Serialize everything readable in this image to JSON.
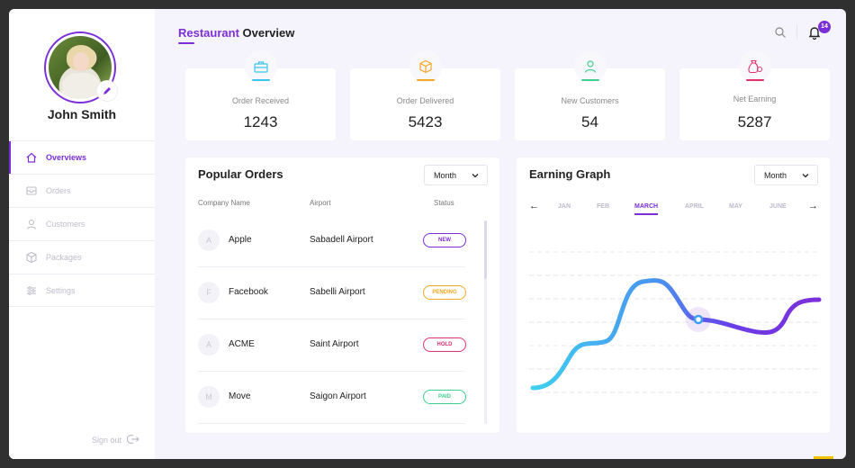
{
  "colors": {
    "accent": "#7b2fd9",
    "new": "#7b2fd9",
    "pending": "#f5a623",
    "hold": "#e0336b",
    "paid": "#3ecf8e"
  },
  "user": {
    "name": "John Smith",
    "edit_icon": "pencil-icon"
  },
  "nav": [
    {
      "label": "Overviews",
      "icon": "home-icon",
      "active": true
    },
    {
      "label": "Orders",
      "icon": "inbox-icon",
      "active": false
    },
    {
      "label": "Customers",
      "icon": "user-icon",
      "active": false
    },
    {
      "label": "Packages",
      "icon": "package-icon",
      "active": false
    },
    {
      "label": "Settings",
      "icon": "sliders-icon",
      "active": false
    }
  ],
  "signout": {
    "label": "Sign out",
    "icon": "sign-out-icon"
  },
  "header": {
    "title_accent": "Restaurant",
    "title_rest": " Overview",
    "notifications": "14"
  },
  "stats": [
    {
      "label": "Order Received",
      "value": "1243",
      "icon": "briefcase-icon",
      "color": "#3cc4e8"
    },
    {
      "label": "Order Delivered",
      "value": "5423",
      "icon": "box-icon",
      "color": "#f5a623"
    },
    {
      "label": "New Customers",
      "value": "54",
      "icon": "user-icon",
      "color": "#3ecf8e"
    },
    {
      "label": "Net Earning",
      "value": "5287",
      "icon": "money-bag-icon",
      "color": "#e0336b"
    }
  ],
  "popular_orders": {
    "title": "Popular Orders",
    "filter": "Month",
    "columns": [
      "Company Name",
      "Airport",
      "Status"
    ],
    "rows": [
      {
        "initial": "A",
        "company": "Apple",
        "airport": "Sabadell Airport",
        "status": "NEW",
        "status_color": "#7b2fd9"
      },
      {
        "initial": "F",
        "company": "Facebook",
        "airport": "Sabelli Airport",
        "status": "PENDING",
        "status_color": "#f5a623"
      },
      {
        "initial": "A",
        "company": "ACME",
        "airport": "Saint Airport",
        "status": "HOLD",
        "status_color": "#e0336b"
      },
      {
        "initial": "M",
        "company": "Move",
        "airport": "Saigon Airport",
        "status": "PAID",
        "status_color": "#3ecf8e"
      }
    ]
  },
  "earning_graph": {
    "title": "Earning Graph",
    "filter": "Month",
    "months": [
      "JAN",
      "FEB",
      "MARCH",
      "APRIL",
      "MAY",
      "JUNE"
    ],
    "active_month": "MARCH",
    "prev_arrow": "←",
    "next_arrow": "→"
  }
}
